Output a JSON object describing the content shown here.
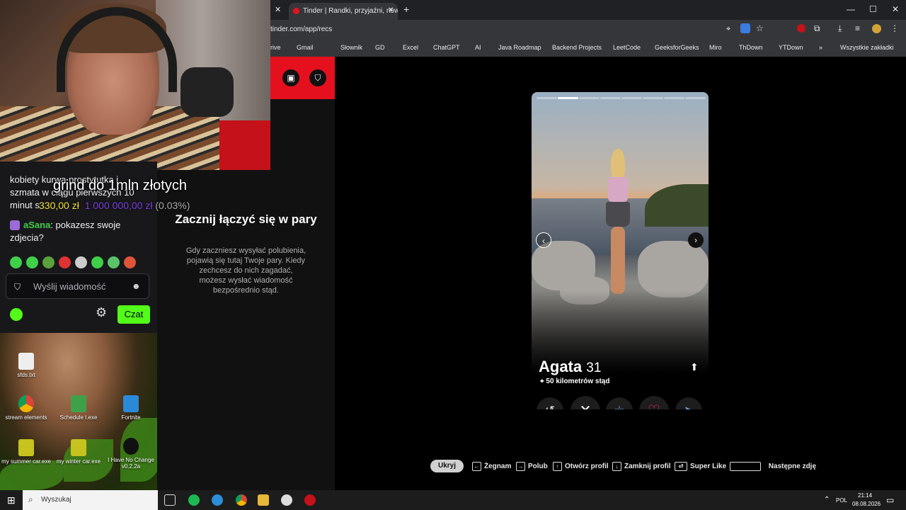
{
  "browser": {
    "tabs": [
      {
        "label": ""
      },
      {
        "label": "Tinder | Randki, przyjaźni, nowe"
      }
    ],
    "url": "tinder.com/app/recs",
    "bookmarks": [
      "rive",
      "Gmail",
      "Słownik",
      "GD",
      "Excel",
      "ChatGPT",
      "AI",
      "Java Roadmap",
      "Backend Projects",
      "LeetCode",
      "GeeksforGeeks",
      "Miro",
      "ThDown",
      "YTDown"
    ],
    "all_bookmarks": "Wszystkie zakładki"
  },
  "stream": {
    "goal_title": "grind do 1mln złotych",
    "goal_current": "330,00 zł",
    "goal_target": "1 000 000,00 zł",
    "goal_percent": "(0.03%)",
    "chat_messages": [
      {
        "text": "kobiety kurwa prostytutka i szmata w ciągu pierwszych 10 minut s"
      },
      {
        "user": "aSana",
        "text": "pokazesz swoje zdjecia?"
      }
    ],
    "input_placeholder": "Wyślij wiadomość",
    "send_label": "Czat"
  },
  "tinder": {
    "empty_title": "Zacznij łączyć się w pary",
    "empty_desc": "Gdy zaczniesz wysyłać polubienia, pojawią się tutaj Twoje pary. Kiedy zechcesz do nich zagadać, możesz wysłać wiadomość bezpośrednio stąd.",
    "profile_name": "Agata",
    "profile_age": "31",
    "profile_distance": "50 kilometrów stąd",
    "photo_count": 8,
    "current_photo": 2
  },
  "hints": {
    "hide": "Ukryj",
    "nope": "Żegnam",
    "like": "Polub",
    "open": "Otwórz profil",
    "close": "Zamknij profil",
    "superlike": "Super Like",
    "next": "Następne zdję"
  },
  "desktop": {
    "icons": [
      "sfds.txt",
      "stream elements",
      "Schedule I.exe",
      "Fortnite",
      "my summer car.exe",
      "my winter car.exe",
      "I Have No Change v0.2.2a"
    ]
  },
  "taskbar": {
    "search_placeholder": "Wyszukaj",
    "language": "POL",
    "time": "21:14",
    "date": "08.08.2026"
  },
  "colors": {
    "tinder_red": "#e5101e",
    "kick_green": "#53fc18",
    "like_red": "#fd267a"
  }
}
